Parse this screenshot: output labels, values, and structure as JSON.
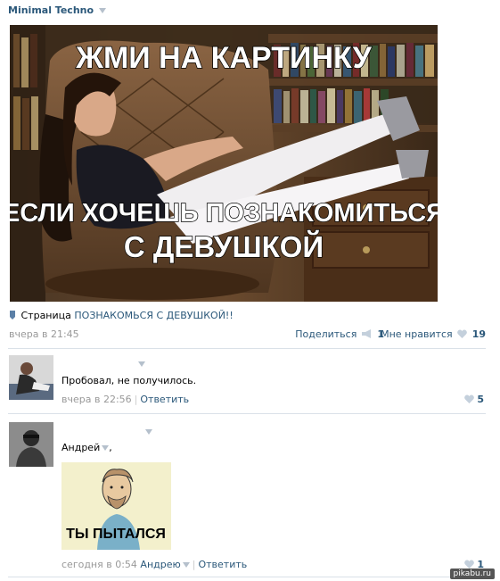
{
  "post": {
    "author": "Minimal Techno",
    "image_top_text": "ЖМИ НА КАРТИНКУ",
    "image_bottom_line1": "ЕСЛИ ХОЧЕШЬ ПОЗНАКОМИТЬСЯ",
    "image_bottom_line2": "С ДЕВУШКОЙ",
    "page_prefix": "Страница",
    "page_link": "ПОЗНАКОМЬСЯ С ДЕВУШКОЙ!!",
    "time": "вчера в 21:45",
    "share_label": "Поделиться",
    "share_count": "1",
    "like_label": "Мне нравится",
    "like_count": "19"
  },
  "comments": [
    {
      "text": "Пробовал, не получилось.",
      "time": "вчера в 22:56",
      "reply_label": "Ответить",
      "likes": "5"
    },
    {
      "text_name": "Андрей",
      "text_suffix": ",",
      "meme_caption": "ТЫ ПЫТАЛСЯ",
      "time": "сегодня в 0:54",
      "reply_to": "Андрею",
      "reply_label": "Ответить",
      "likes": "1"
    }
  ],
  "watermark": "pikabu.ru",
  "colors": {
    "link": "#2b587a",
    "meta": "#999999",
    "divider": "#dae1e8",
    "heart": "#c4d0dc"
  }
}
